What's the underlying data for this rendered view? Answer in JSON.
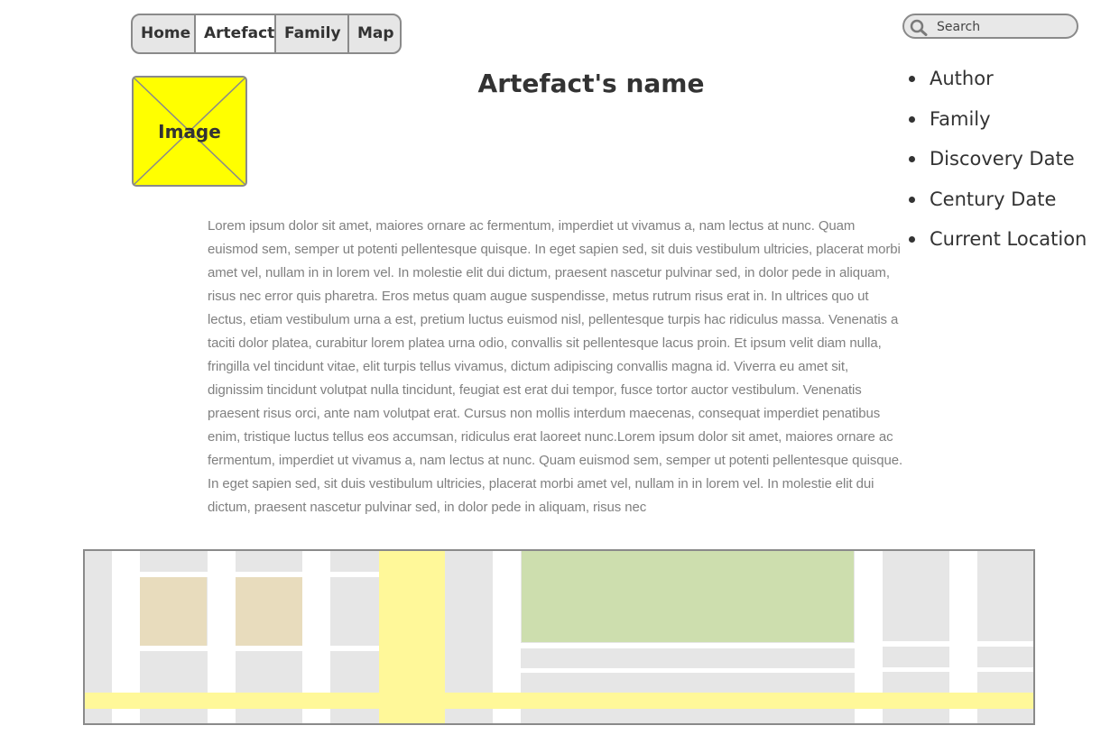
{
  "nav": {
    "tabs": [
      {
        "label": "Home",
        "active": false
      },
      {
        "label": "Artefact",
        "active": true
      },
      {
        "label": "Family",
        "active": false
      },
      {
        "label": "Map",
        "active": false
      }
    ]
  },
  "search": {
    "placeholder": "Search",
    "value": "",
    "icon": "search-icon"
  },
  "artefact": {
    "image_label": "Image",
    "image_color": "#ffff00",
    "title": "Artefact's name",
    "description": "Lorem ipsum dolor sit amet, maiores ornare ac fermentum, imperdiet ut vivamus a, nam lectus at nunc. Quam euismod sem, semper ut potenti pellentesque quisque. In eget sapien sed, sit duis vestibulum ultricies, placerat morbi amet vel, nullam in in lorem vel. In molestie elit dui dictum, praesent nascetur pulvinar sed, in dolor pede in aliquam, risus nec error quis pharetra. Eros metus quam augue suspendisse, metus rutrum risus erat in.  In ultrices quo ut lectus, etiam vestibulum urna a est, pretium luctus euismod nisl, pellentesque turpis hac ridiculus massa. Venenatis a taciti dolor platea, curabitur lorem platea urna odio, convallis sit pellentesque lacus proin. Et ipsum velit diam nulla, fringilla vel tincidunt vitae, elit turpis tellus vivamus, dictum adipiscing convallis magna id. Viverra eu amet sit, dignissim tincidunt volutpat nulla tincidunt, feugiat est erat dui tempor, fusce tortor auctor vestibulum. Venenatis praesent risus orci, ante nam volutpat erat. Cursus non mollis interdum maecenas, consequat imperdiet penatibus enim, tristique luctus tellus eos accumsan, ridiculus erat laoreet nunc.Lorem ipsum dolor sit amet, maiores ornare ac fermentum, imperdiet ut vivamus a, nam lectus at nunc. Quam euismod sem, semper ut potenti pellentesque quisque. In eget sapien sed, sit duis vestibulum ultricies, placerat morbi amet vel, nullam in in lorem vel. In molestie elit dui dictum, praesent nascetur pulvinar sed, in dolor pede in aliquam, risus nec"
  },
  "details": {
    "items": [
      "Author",
      "Family",
      "Discovery Date",
      "Century Date",
      "Current Location"
    ]
  },
  "map": {
    "colors": {
      "block": "#e6e6e6",
      "road": "#ffffff",
      "highlight_road": "#fff899",
      "park": "#cddeae",
      "building": "#e8dcbd"
    }
  }
}
